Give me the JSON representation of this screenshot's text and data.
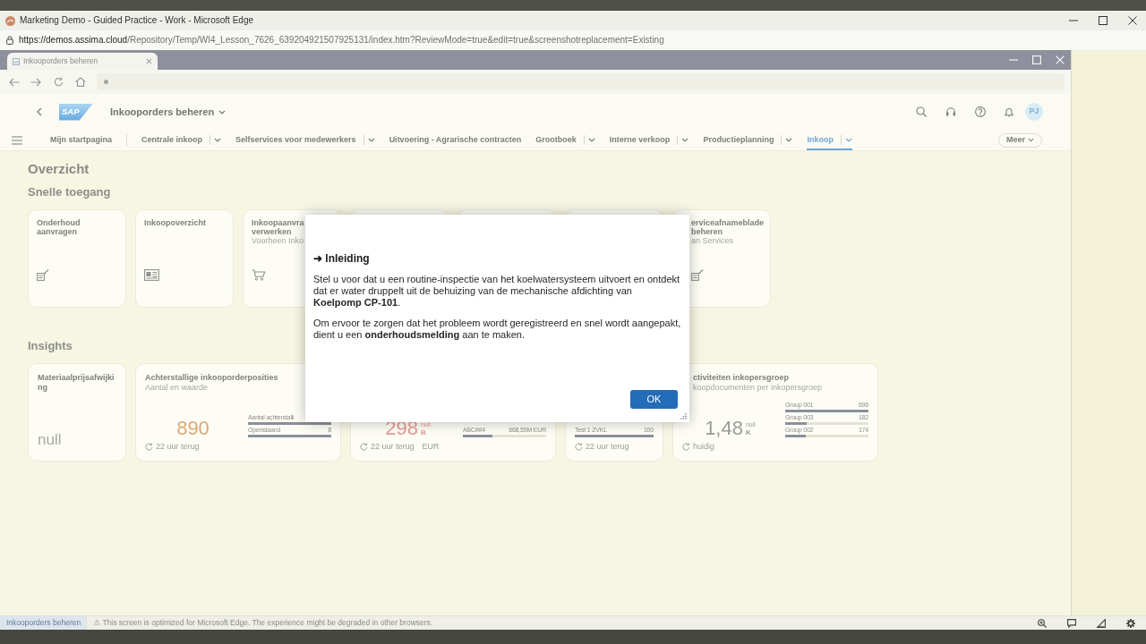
{
  "window": {
    "title": "Marketing Demo - Guided Practice - Work - Microsoft Edge"
  },
  "address_bar": {
    "host": "https://demos.assima.cloud",
    "path": "/Repository/Temp/WI4_Lesson_7626_639204921507925131/index.htm?ReviewMode=true&edit=true&screenshotreplacement=Existing"
  },
  "inner_tab": {
    "title": "Inkooporders beheren"
  },
  "shell": {
    "logo": "SAP",
    "app_title": "Inkooporders beheren",
    "user_initials": "PJ"
  },
  "nav": {
    "items": [
      {
        "label": "Mijn startpagina",
        "has_menu": false,
        "selected": false
      },
      {
        "label": "Centrale inkoop",
        "has_menu": true,
        "selected": false
      },
      {
        "label": "Selfservices voor medewerkers",
        "has_menu": true,
        "selected": false
      },
      {
        "label": "Uitvoering - Agrarische contracten",
        "has_menu": false,
        "selected": false
      },
      {
        "label": "Grootboek",
        "has_menu": true,
        "selected": false
      },
      {
        "label": "Interne verkoop",
        "has_menu": true,
        "selected": false
      },
      {
        "label": "Productieplanning",
        "has_menu": true,
        "selected": false
      },
      {
        "label": "Inkoop",
        "has_menu": true,
        "selected": true
      }
    ],
    "more_button": "Meer"
  },
  "page": {
    "title": "Overzicht",
    "quick_access": {
      "heading": "Snelle toegang",
      "tiles": [
        {
          "kind": "app",
          "title": "Onderhoud aanvragen"
        },
        {
          "kind": "app",
          "title": "Inkoopoverzicht"
        },
        {
          "kind": "app",
          "title": "Inkoopaanvra verwerken",
          "subtitle": "Voorheen Inko"
        },
        {
          "kind": "covered"
        },
        {
          "kind": "covered"
        },
        {
          "kind": "covered"
        },
        {
          "kind": "app",
          "title": "erviceafnameblade beheren",
          "subtitle": "an Services"
        }
      ]
    },
    "insights": {
      "heading": "Insights",
      "cards": [
        {
          "kind": "numeric",
          "title": "Materiaalprijsafwijking",
          "value": "null"
        },
        {
          "kind": "kpi",
          "title": "Achterstallige inkooporderposities",
          "subtitle": "Aantal en waarde",
          "value": "890",
          "color": "#d9a878",
          "rows": [
            {
              "label": "Aantal achterstalli",
              "level": 1
            },
            {
              "label": "Openstaand",
              "value": "8",
              "level": 1
            }
          ],
          "refreshed": "22 uur terug"
        },
        {
          "kind": "kpi",
          "value": "298",
          "color": "#e59b94",
          "scale": "null",
          "unit": "B",
          "rows": [
            {
              "label": "ABC##4",
              "value": "668,55M EUR",
              "level": 0.35
            }
          ],
          "refreshed": "22 uur terug",
          "currency": "EUR"
        },
        {
          "kind": "list",
          "rows": [
            {
              "label": "Test 1 ZVKL",
              "value": "100",
              "level": 1
            }
          ],
          "refreshed": "22 uur terug"
        },
        {
          "kind": "kpi",
          "title": "ctiviteiten inkopersgroep",
          "subtitle": "koopdocumenten per inkopersgroep",
          "value": "1,48",
          "color": "#9a9c97",
          "scale": "null",
          "unit": "K",
          "rows": [
            {
              "label": "Group 001",
              "value": "696",
              "level": 1
            },
            {
              "label": "Group 003",
              "value": "182",
              "level": 0.26
            },
            {
              "label": "Group 002",
              "value": "174",
              "level": 0.25
            }
          ],
          "refreshed": "huidig"
        }
      ]
    }
  },
  "dialog": {
    "title": "➜ Inleiding",
    "paragraphs": [
      "Stel u voor dat u een routine-inspectie van het koelwatersysteem uitvoert en ontdekt dat er water druppelt uit de behuizing van de mechanische afdichting van **Koelpomp CP-101**.",
      "Om ervoor te zorgen dat het probleem wordt geregistreerd en snel wordt aangepakt, dient u een **onderhoudsmelding** aan te maken."
    ],
    "button": "OK"
  },
  "status_bar": {
    "tab": "Inkooporders beheren",
    "notice": "⚠ This screen is optimized for Microsoft Edge. The experience might be degraded in other browsers."
  }
}
